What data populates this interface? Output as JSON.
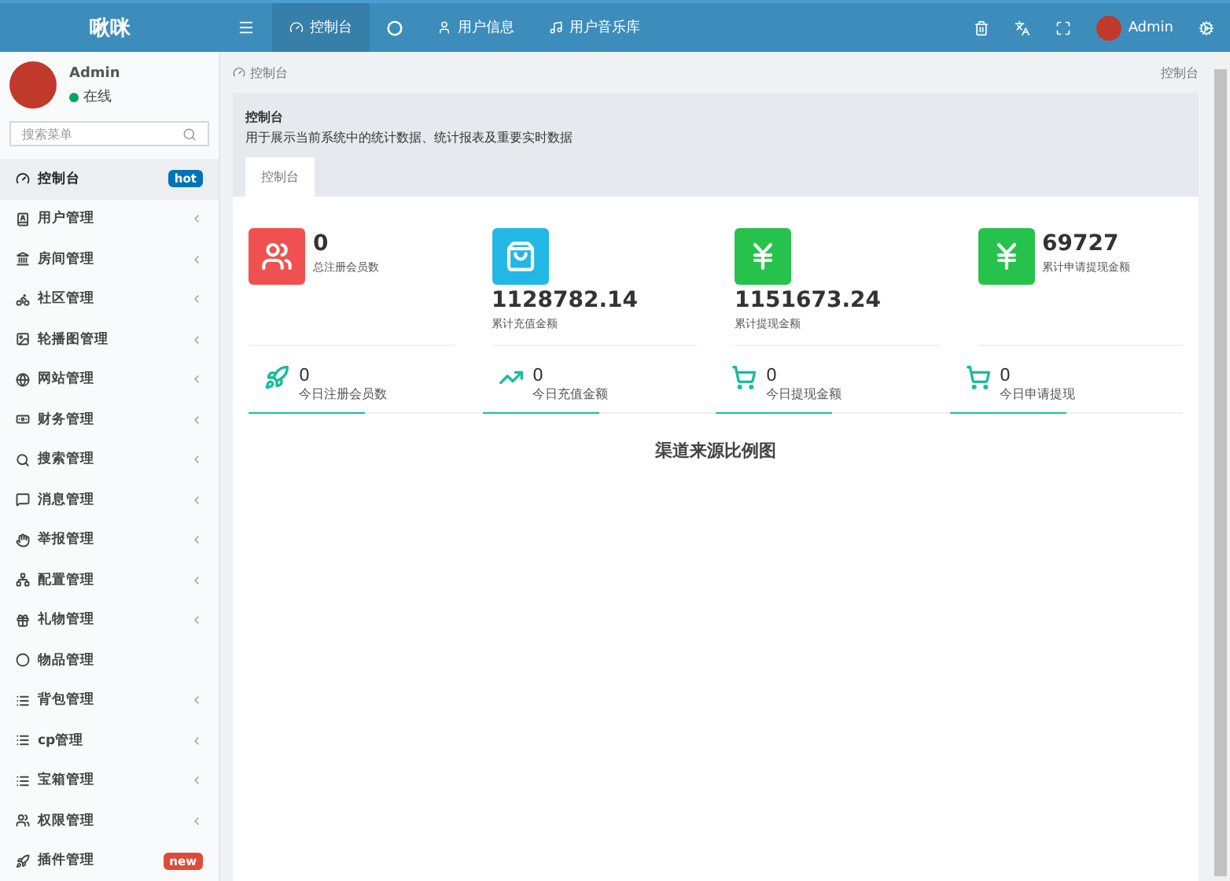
{
  "header": {
    "logo": "啾咪",
    "nav": [
      {
        "label": "控制台",
        "selected": true
      },
      {
        "selected": false
      },
      {
        "label": "用户信息",
        "selected": false
      },
      {
        "label": "用户音乐库",
        "selected": false
      }
    ],
    "user": "Admin"
  },
  "sidebar": {
    "user": {
      "name": "Admin",
      "status": "在线"
    },
    "search": {
      "placeholder": "搜索菜单"
    },
    "items": [
      {
        "label": "控制台",
        "selected": true,
        "badge": {
          "text": "hot",
          "color": "#0073b7"
        }
      },
      {
        "label": "用户管理",
        "selected": false,
        "expandable": true
      },
      {
        "label": "房间管理",
        "selected": false,
        "expandable": true
      },
      {
        "label": "社区管理",
        "selected": false,
        "expandable": true
      },
      {
        "label": "轮播图管理",
        "selected": false,
        "expandable": true
      },
      {
        "label": "网站管理",
        "selected": false,
        "expandable": true
      },
      {
        "label": "财务管理",
        "selected": false,
        "expandable": true
      },
      {
        "label": "搜索管理",
        "selected": false,
        "expandable": true
      },
      {
        "label": "消息管理",
        "selected": false,
        "expandable": true
      },
      {
        "label": "举报管理",
        "selected": false,
        "expandable": true
      },
      {
        "label": "配置管理",
        "selected": false,
        "expandable": true
      },
      {
        "label": "礼物管理",
        "selected": false,
        "expandable": true
      },
      {
        "label": "物品管理",
        "selected": false,
        "expandable": false
      },
      {
        "label": "背包管理",
        "selected": false,
        "expandable": true
      },
      {
        "label": "cp管理",
        "selected": false,
        "expandable": true
      },
      {
        "label": "宝箱管理",
        "selected": false,
        "expandable": true
      },
      {
        "label": "权限管理",
        "selected": false,
        "expandable": true
      },
      {
        "label": "插件管理",
        "selected": false,
        "badge": {
          "text": "new",
          "color": "#dd4b39"
        }
      }
    ]
  },
  "breadcrumb": {
    "left": "控制台",
    "right": "控制台"
  },
  "panel": {
    "title": "控制台",
    "description": "用于展示当前系统中的统计数据、统计报表及重要实时数据",
    "tabs": [
      {
        "label": "控制台",
        "selected": true
      }
    ]
  },
  "stats": [
    {
      "value": "0",
      "label": "总注册会员数",
      "color": "#f05050",
      "kind": "side"
    },
    {
      "value": "1128782.14",
      "label": "累计充值金额",
      "color": "#23b7e5",
      "kind": "below"
    },
    {
      "value": "1151673.24",
      "label": "累计提现金额",
      "color": "#27c24c",
      "kind": "below"
    },
    {
      "value": "69727",
      "label": "累计申请提现金额",
      "color": "#27c24c",
      "kind": "side"
    }
  ],
  "today": [
    {
      "value": "0",
      "label": "今日注册会员数"
    },
    {
      "value": "0",
      "label": "今日充值金额"
    },
    {
      "value": "0",
      "label": "今日提现金额"
    },
    {
      "value": "0",
      "label": "今日申请提现"
    }
  ],
  "chart_title": "渠道来源比例图"
}
